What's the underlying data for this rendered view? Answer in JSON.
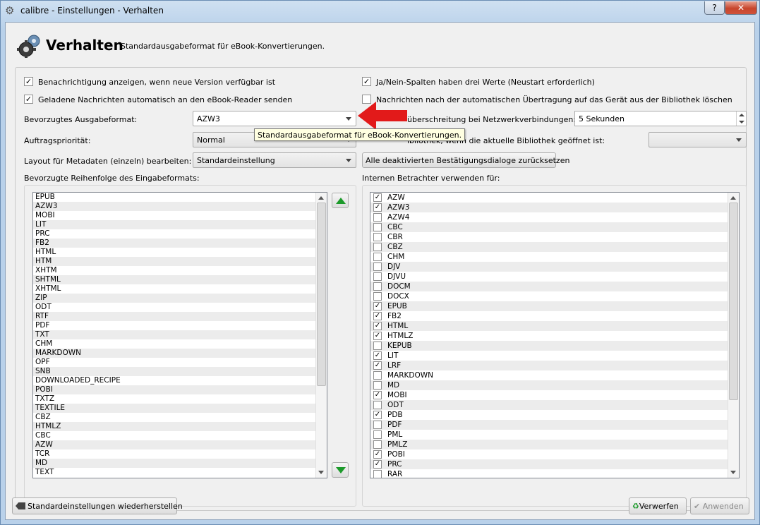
{
  "window": {
    "title": "calibre - Einstellungen - Verhalten",
    "help": "?",
    "close": "✕"
  },
  "header": {
    "title": "Verhalten",
    "description": "Standardausgabeformat für eBook-Konvertierungen."
  },
  "options": {
    "notify_new_version": {
      "label": "Benachrichtigung anzeigen, wenn neue Version verfügbar ist",
      "checked": true
    },
    "auto_send_news": {
      "label": "Geladene Nachrichten automatisch an den eBook-Reader senden",
      "checked": true
    },
    "yes_no_three_values": {
      "label": "Ja/Nein-Spalten haben drei Werte (Neustart erforderlich)",
      "checked": true
    },
    "delete_news": {
      "label": "Nachrichten nach der automatischen Übertragung auf das Gerät aus der Bibliothek löschen",
      "checked": false
    }
  },
  "fields": {
    "output_format_label": "Bevorzugtes Ausgabeformat:",
    "output_format_value": "AZW3",
    "priority_label": "Auftragspriorität:",
    "priority_value": "Normal",
    "metadata_layout_label": "Layout für Metadaten (einzeln) bearbeiten:",
    "metadata_layout_value": "Standardeinstellung",
    "timeout_label": "überschreitung bei Netzwerkverbindungen:",
    "timeout_value": "5 Sekunden",
    "virtual_lib_label": "ibliothek, wenn die aktuelle Bibliothek geöffnet ist:",
    "virtual_lib_value": "",
    "reset_dialogs_button": "Alle deaktivierten Bestätigungsdialoge zurücksetzen"
  },
  "tooltip": "Standardausgabeformat für eBook-Konvertierungen.",
  "input_order": {
    "label": "Bevorzugte Reihenfolge des Eingabeformats:",
    "items": [
      "EPUB",
      "AZW3",
      "MOBI",
      "LIT",
      "PRC",
      "FB2",
      "HTML",
      "HTM",
      "XHTM",
      "SHTML",
      "XHTML",
      "ZIP",
      "ODT",
      "RTF",
      "PDF",
      "TXT",
      "CHM",
      "MARKDOWN",
      "OPF",
      "SNB",
      "DOWNLOADED_RECIPE",
      "POBI",
      "TXTZ",
      "TEXTILE",
      "CBZ",
      "HTMLZ",
      "CBC",
      "AZW",
      "TCR",
      "MD",
      "TEXT"
    ]
  },
  "internal_viewer": {
    "label": "Internen Betrachter verwenden für:",
    "items": [
      {
        "name": "AZW",
        "checked": true
      },
      {
        "name": "AZW3",
        "checked": true
      },
      {
        "name": "AZW4",
        "checked": false
      },
      {
        "name": "CBC",
        "checked": false
      },
      {
        "name": "CBR",
        "checked": false
      },
      {
        "name": "CBZ",
        "checked": false
      },
      {
        "name": "CHM",
        "checked": false
      },
      {
        "name": "DJV",
        "checked": false
      },
      {
        "name": "DJVU",
        "checked": false
      },
      {
        "name": "DOCM",
        "checked": false
      },
      {
        "name": "DOCX",
        "checked": false
      },
      {
        "name": "EPUB",
        "checked": true
      },
      {
        "name": "FB2",
        "checked": true
      },
      {
        "name": "HTML",
        "checked": true
      },
      {
        "name": "HTMLZ",
        "checked": true
      },
      {
        "name": "KEPUB",
        "checked": false
      },
      {
        "name": "LIT",
        "checked": true
      },
      {
        "name": "LRF",
        "checked": true
      },
      {
        "name": "MARKDOWN",
        "checked": false
      },
      {
        "name": "MD",
        "checked": false
      },
      {
        "name": "MOBI",
        "checked": true
      },
      {
        "name": "ODT",
        "checked": false
      },
      {
        "name": "PDB",
        "checked": true
      },
      {
        "name": "PDF",
        "checked": false
      },
      {
        "name": "PML",
        "checked": false
      },
      {
        "name": "PMLZ",
        "checked": false
      },
      {
        "name": "POBI",
        "checked": true
      },
      {
        "name": "PRC",
        "checked": true
      },
      {
        "name": "RAR",
        "checked": false
      }
    ]
  },
  "footer": {
    "restore_defaults": "Standardeinstellungen wiederherstellen",
    "discard": "Verwerfen",
    "apply": "Anwenden"
  },
  "colors": {
    "accent_green": "#1c9a2a",
    "arrow_red": "#e21a1a",
    "tooltip_bg": "#ffffe1"
  }
}
